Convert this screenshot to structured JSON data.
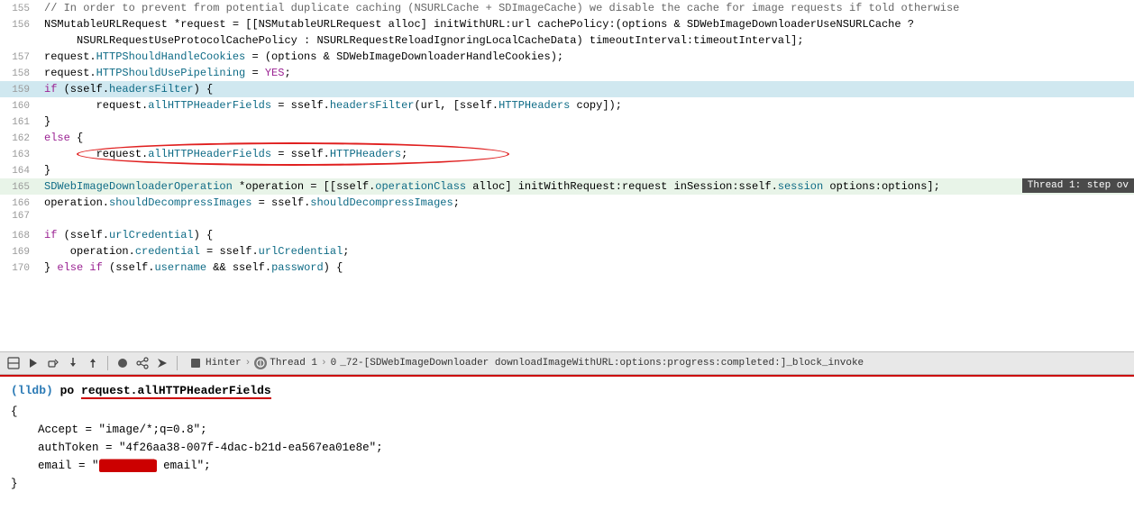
{
  "colors": {
    "highlight_green": "#e8f4e8",
    "active_blue": "#d0e8f0",
    "red": "#cc0000",
    "thread_badge_bg": "#4a4a4a"
  },
  "toolbar": {
    "breadcrumb_hinter": "Hinter",
    "breadcrumb_thread": "Thread 1",
    "breadcrumb_frame": "0",
    "breadcrumb_func": "_72-[SDWebImageDownloader downloadImageWithURL:options:progress:completed:]_block_invoke",
    "thread_step_label": "Thread 1: step ov"
  },
  "console": {
    "prompt": "(lldb)",
    "command": "po request.allHTTPHeaderFields",
    "output_open": "{",
    "output_accept_key": "Accept",
    "output_accept_val": "\"image/*;q=0.8\"",
    "output_authtoken_key": "authToken",
    "output_authtoken_val": "\"4f26aa38-007f-4dac-b21d-ea567ea01e8e\"",
    "output_email_key": "email",
    "output_email_val": "\" email\"",
    "output_close": "}"
  },
  "lines": [
    {
      "num": "155",
      "highlighted": false,
      "content": "// In order to prevent from potential duplicate caching (NSURLCache + SDImageCache) we disable the cache for image requests if told otherwise"
    },
    {
      "num": "156",
      "highlighted": false,
      "content": "NSMutableURLRequest *request = [[NSMutableURLRequest alloc] initWithURL:url cachePolicy:(options & SDWebImageDownloaderUseNSURLCache ?"
    },
    {
      "num": "",
      "highlighted": false,
      "content": "     NSURLRequestUseProtocolCachePolicy : NSURLRequestReloadIgnoringLocalCacheData) timeoutInterval:timeoutInterval];"
    },
    {
      "num": "157",
      "highlighted": false,
      "content": "request.HTTPShouldHandleCookies = (options & SDWebImageDownloaderHandleCookies);"
    },
    {
      "num": "158",
      "highlighted": false,
      "content": "request.HTTPShouldUsePipelining = YES;"
    },
    {
      "num": "159",
      "highlighted": false,
      "content": "if (sself.headersFilter) {"
    },
    {
      "num": "160",
      "highlighted": false,
      "content": "    request.allHTTPHeaderFields = sself.headersFilter(url, [sself.HTTPHeaders copy]);"
    },
    {
      "num": "161",
      "highlighted": false,
      "content": "}"
    },
    {
      "num": "162",
      "highlighted": false,
      "content": "else {"
    },
    {
      "num": "163",
      "highlighted": false,
      "content": "    request.allHTTPHeaderFields = sself.HTTPHeaders;"
    },
    {
      "num": "164",
      "highlighted": false,
      "content": "}"
    },
    {
      "num": "165",
      "highlighted": true,
      "content": "SDWebImageDownloaderOperation *operation = [[sself.operationClass alloc] initWithRequest:request inSession:sself.session options:options];"
    },
    {
      "num": "166",
      "highlighted": false,
      "content": "operation.shouldDecompressImages = sself.shouldDecompressImages;"
    },
    {
      "num": "167",
      "highlighted": false,
      "content": ""
    },
    {
      "num": "168",
      "highlighted": false,
      "content": "if (sself.urlCredential) {"
    },
    {
      "num": "169",
      "highlighted": false,
      "content": "    operation.credential = sself.urlCredential;"
    },
    {
      "num": "170",
      "highlighted": false,
      "content": "} else if (sself.username && sself.password) {"
    }
  ]
}
